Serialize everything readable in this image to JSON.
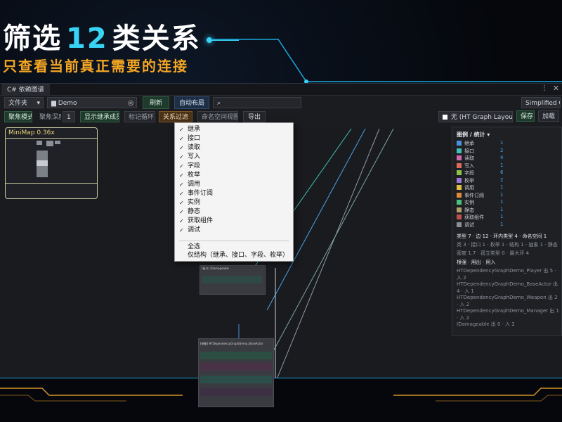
{
  "headline": {
    "prefix": "筛选",
    "number": "12",
    "suffix": "类关系"
  },
  "subhead": "只查看当前真正需要的连接",
  "window": {
    "tab_title": "C# 依赖图谱",
    "menu_dots": "⋮",
    "close": "✕"
  },
  "toolbar1": {
    "scope_select": "文件夹",
    "folder_path": "Demo",
    "refresh": "刷新",
    "auto_layout": "自动布局",
    "search_placeholder": "",
    "layout_mode": "Simplified C"
  },
  "toolbar2": {
    "focus_mode": "聚焦模式",
    "focus_depth_label": "聚焦深度",
    "focus_depth_value": "1",
    "show_inherited": "显示继承成员",
    "mark_cycles": "标记循环",
    "relation_filter": "关系过滤",
    "namespace_view": "命名空间视图",
    "export": "导出",
    "layout_profile": "无 (HT Graph Layout Pro",
    "save": "保存",
    "load": "加载"
  },
  "minimap": {
    "label": "MiniMap  0.36x"
  },
  "relation_menu": {
    "items": [
      {
        "label": "继承",
        "checked": "✓"
      },
      {
        "label": "接口",
        "checked": "✓"
      },
      {
        "label": "读取",
        "checked": "✓"
      },
      {
        "label": "写入",
        "checked": "✓"
      },
      {
        "label": "字段",
        "checked": "✓"
      },
      {
        "label": "枚举",
        "checked": "✓"
      },
      {
        "label": "调用",
        "checked": "✓"
      },
      {
        "label": "事件订阅",
        "checked": "✓"
      },
      {
        "label": "实例",
        "checked": "✓"
      },
      {
        "label": "静态",
        "checked": "✓"
      },
      {
        "label": "获取组件",
        "checked": "✓"
      },
      {
        "label": "调试",
        "checked": "✓"
      }
    ],
    "select_all": "全选",
    "structure_only": "仅结构（继承、接口、字段、枚举）"
  },
  "stats_panel": {
    "header": "图例 / 统计 ▾",
    "legend": [
      {
        "name": "继承",
        "count": "1",
        "color": "#4a8fe0"
      },
      {
        "name": "接口",
        "count": "2",
        "color": "#3fc0b8"
      },
      {
        "name": "读取",
        "count": "4",
        "color": "#d06ab0"
      },
      {
        "name": "写入",
        "count": "1",
        "color": "#e06a5a"
      },
      {
        "name": "字段",
        "count": "6",
        "color": "#8cc44a"
      },
      {
        "name": "枚举",
        "count": "2",
        "color": "#9a78d8"
      },
      {
        "name": "调用",
        "count": "1",
        "color": "#e0c040"
      },
      {
        "name": "事件订阅",
        "count": "1",
        "color": "#e08a3a"
      },
      {
        "name": "实例",
        "count": "1",
        "color": "#4ac07a"
      },
      {
        "name": "静态",
        "count": "1",
        "color": "#b0a070"
      },
      {
        "name": "获取组件",
        "count": "1",
        "color": "#c05050"
      },
      {
        "name": "调试",
        "count": "1",
        "color": "#8a8f98"
      }
    ],
    "summary1": "类型 7 · 边 12 · 环内类型 4 · 命名空间 1",
    "summary2": "类 3 · 接口 1 · 枚举 1 · 结构 1 · 抽象 1 · 静态 0",
    "summary3": "密度 1.7 · 孤立类型 0 · 最大环 4",
    "roots_header": "根强 · 用出 · 用入",
    "roots": [
      "HTDependencyGraphDemo_Player 出 5 · 入 2",
      "HTDependencyGraphDemo_BaseActor 出 4 · 入 1",
      "HTDependencyGraphDemo_Weapon 出 2 · 入 2",
      "HTDependencyGraphDemo_Manager 出 1 · 入 2",
      "IDamageable 出 0 · 入 2"
    ]
  },
  "graph": {
    "node1_title": "[接口] IDamageable",
    "node2_title": "[抽象] HTDependencyGraphDemo_BaseActor"
  }
}
